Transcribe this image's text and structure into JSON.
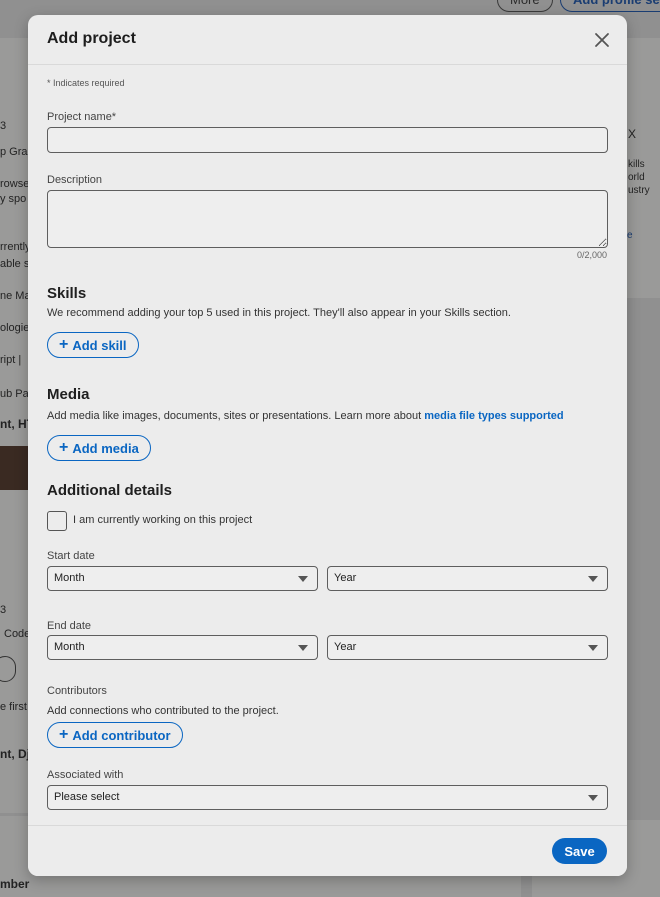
{
  "background": {
    "top_pills": [
      "More",
      "Add profile se"
    ],
    "left_fragments": [
      "3",
      "p Gra",
      "rowse",
      "y spo",
      "rrently",
      "able s",
      "ne Ma",
      "ologies",
      "ript |",
      "ub Pa",
      "nt, HT",
      "3",
      "Code",
      "e first",
      "nt, Dj",
      "mber"
    ],
    "right_fragments": [
      "X",
      "kills",
      "orld",
      "ustry",
      "e"
    ]
  },
  "modal": {
    "title": "Add project",
    "required_note": "* Indicates required",
    "project_name": {
      "label": "Project name*",
      "value": ""
    },
    "description": {
      "label": "Description",
      "value": "",
      "counter": "0/2,000"
    },
    "skills": {
      "title": "Skills",
      "description": "We recommend adding your top 5 used in this project. They'll also appear in your Skills section.",
      "button": "Add skill"
    },
    "media": {
      "title": "Media",
      "description": "Add media like images, documents, sites or presentations. Learn more about ",
      "link": "media file types supported",
      "button": "Add media"
    },
    "additional": {
      "title": "Additional details",
      "checkbox_label": "I am currently working on this project",
      "start_date": {
        "label": "Start date",
        "month": "Month",
        "year": "Year"
      },
      "end_date": {
        "label": "End date",
        "month": "Month",
        "year": "Year"
      },
      "contributors": {
        "label": "Contributors",
        "description": "Add connections who contributed to the project.",
        "button": "Add contributor"
      },
      "associated": {
        "label": "Associated with",
        "value": "Please select"
      }
    },
    "save_label": "Save"
  },
  "colors": {
    "accent": "#0a66c2",
    "modal_bg": "#ececec",
    "overlay": "#909090"
  }
}
